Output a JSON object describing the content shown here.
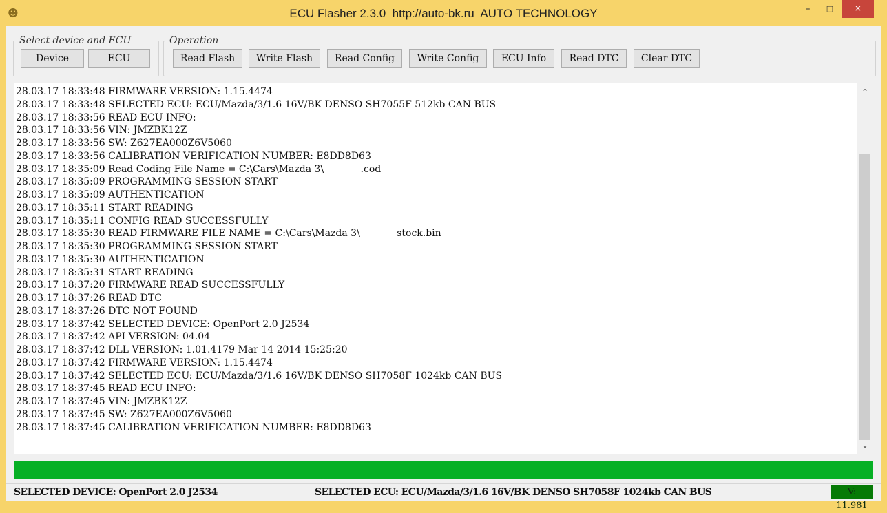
{
  "window": {
    "title": "ECU Flasher 2.3.0  http://auto-bk.ru  AUTO TECHNOLOGY",
    "app_icon": "cat-face-icon",
    "minimize": "–",
    "maximize": "□",
    "close": "×"
  },
  "groups": {
    "device": {
      "legend": "Select device and ECU",
      "buttons": [
        "Device",
        "ECU"
      ]
    },
    "operation": {
      "legend": "Operation",
      "buttons": [
        "Read Flash",
        "Write Flash",
        "Read Config",
        "Write Config",
        "ECU Info",
        "Read DTC",
        "Clear DTC"
      ]
    }
  },
  "log": {
    "lines": [
      "28.03.17 18:33:48 FIRMWARE VERSION: 1.15.4474",
      "28.03.17 18:33:48 SELECTED ECU: ECU/Mazda/3/1.6 16V/BK DENSO SH7055F 512kb CAN BUS",
      "28.03.17 18:33:56 READ ECU INFO:",
      "28.03.17 18:33:56 VIN: JMZBK12Z",
      "28.03.17 18:33:56 SW: Z627EA000Z6V5060",
      "28.03.17 18:33:56 CALIBRATION VERIFICATION NUMBER: E8DD8D63",
      "28.03.17 18:35:09 Read Coding File Name = C:\\Cars\\Mazda 3\\            .cod",
      "28.03.17 18:35:09 PROGRAMMING SESSION START",
      "28.03.17 18:35:09 AUTHENTICATION",
      "28.03.17 18:35:11 START READING",
      "28.03.17 18:35:11 CONFIG READ SUCCESSFULLY",
      "28.03.17 18:35:30 READ FIRMWARE FILE NAME = C:\\Cars\\Mazda 3\\            stock.bin",
      "28.03.17 18:35:30 PROGRAMMING SESSION START",
      "28.03.17 18:35:30 AUTHENTICATION",
      "28.03.17 18:35:31 START READING",
      "28.03.17 18:37:20 FIRMWARE READ SUCCESSFULLY",
      "28.03.17 18:37:26 READ DTC",
      "28.03.17 18:37:26 DTC NOT FOUND",
      "28.03.17 18:37:42 SELECTED DEVICE: OpenPort 2.0 J2534",
      "28.03.17 18:37:42 API VERSION: 04.04",
      "28.03.17 18:37:42 DLL VERSION: 1.01.4179 Mar 14 2014 15:25:20",
      "28.03.17 18:37:42 FIRMWARE VERSION: 1.15.4474",
      "28.03.17 18:37:42 SELECTED ECU: ECU/Mazda/3/1.6 16V/BK DENSO SH7058F 1024kb CAN BUS",
      "28.03.17 18:37:45 READ ECU INFO:",
      "28.03.17 18:37:45 VIN: JMZBK12Z",
      "28.03.17 18:37:45 SW: Z627EA000Z6V5060",
      "28.03.17 18:37:45 CALIBRATION VERIFICATION NUMBER: E8DD8D63"
    ],
    "scroll_up_icon": "chevron-up-icon",
    "scroll_down_icon": "chevron-down-icon"
  },
  "progress": {
    "percent": 100,
    "color": "#06b025"
  },
  "status": {
    "device": "SELECTED DEVICE: OpenPort 2.0 J2534",
    "ecu": "SELECTED ECU: ECU/Mazda/3/1.6 16V/BK DENSO SH7058F 1024kb CAN BUS",
    "version": "V: 11.981",
    "version_color": "#067a06"
  }
}
